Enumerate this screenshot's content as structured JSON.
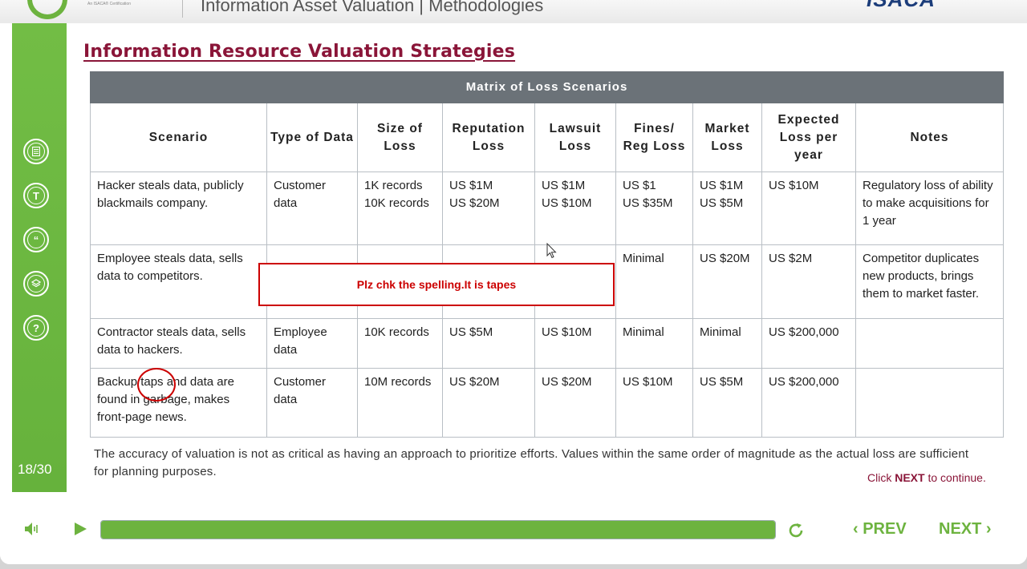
{
  "header": {
    "logo_subtext": "An ISACA® Certification",
    "title": "Information Asset Valuation | Methodologies",
    "brand": "ISACA"
  },
  "sidebar": {
    "icons": [
      "notes-icon",
      "transcript-icon",
      "quote-icon",
      "layers-icon",
      "help-icon"
    ],
    "page_counter": "18/30"
  },
  "slide": {
    "title": "Information Resource Valuation Strategies",
    "table": {
      "caption": "Matrix of Loss Scenarios",
      "headers": [
        "Scenario",
        "Type of Data",
        "Size of Loss",
        "Reputation Loss",
        "Lawsuit Loss",
        "Fines/ Reg Loss",
        "Market Loss",
        "Expected Loss per year",
        "Notes"
      ],
      "rows": [
        {
          "scenario": "Hacker steals data, publicly blackmails company.",
          "type": "Customer data",
          "size": [
            "1K records",
            "10K records"
          ],
          "reputation": [
            "US $1M",
            "US $20M"
          ],
          "lawsuit": [
            "US $1M",
            "US $10M"
          ],
          "fines": [
            "US $1",
            "US $35M"
          ],
          "market": [
            "US $1M",
            "US $5M"
          ],
          "expected": "US $10M",
          "notes": "Regulatory loss of ability to make acquisitions for 1 year"
        },
        {
          "scenario": "Employee steals data, sells data to competitors.",
          "type": "",
          "size": [],
          "reputation": [],
          "lawsuit": [],
          "fines": [
            "Minimal"
          ],
          "market": [
            "US $20M"
          ],
          "expected": "US $2M",
          "notes": "Competitor duplicates new products, brings them to market faster."
        },
        {
          "scenario": "Contractor steals data, sells data to hackers.",
          "type": "Employee data",
          "size": [
            "10K records"
          ],
          "reputation": [
            "US $5M"
          ],
          "lawsuit": [
            "US $10M"
          ],
          "fines": [
            "Minimal"
          ],
          "market": [
            "Minimal"
          ],
          "expected": "US $200,000",
          "notes": ""
        },
        {
          "scenario": "Backup taps and data are found in garbage, makes front-page news.",
          "type": "Customer data",
          "size": [
            "10M records"
          ],
          "reputation": [
            "US $20M"
          ],
          "lawsuit": [
            "US $20M"
          ],
          "fines": [
            "US $10M"
          ],
          "market": [
            "US $5M"
          ],
          "expected": "US $200,000",
          "notes": ""
        }
      ]
    },
    "footnote": "The accuracy of valuation is not as critical as having an approach to prioritize efforts. Values within the same order of magnitude as the actual loss are sufficient for planning purposes.",
    "click_prefix": "Click ",
    "click_next": "NEXT",
    "click_suffix": " to continue."
  },
  "annotation": {
    "callout_text": "Plz chk the spelling.It is tapes"
  },
  "player": {
    "progress_percent": 100,
    "prev_label": "PREV",
    "next_label": "NEXT",
    "accent_color": "#6db33f"
  }
}
